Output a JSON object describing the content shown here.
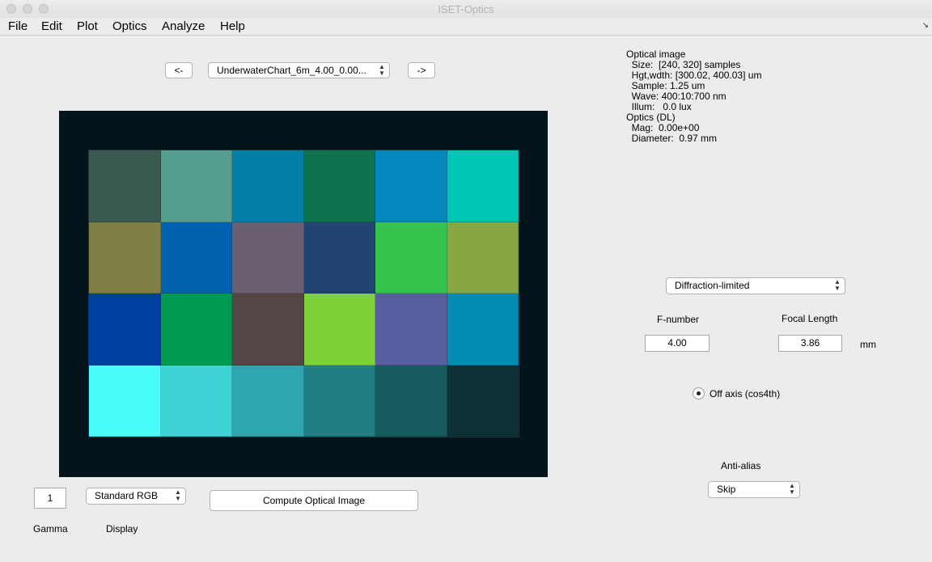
{
  "window": {
    "title": "ISET-Optics"
  },
  "menu": [
    "File",
    "Edit",
    "Plot",
    "Optics",
    "Analyze",
    "Help"
  ],
  "nav": {
    "prev_label": "<-",
    "next_label": "->",
    "scene_selected": "UnderwaterChart_6m_4.00_0.00..."
  },
  "info": {
    "lines": [
      "Optical image",
      "  Size:  [240, 320] samples",
      "  Hgt,wdth: [300.02, 400.03] um",
      "  Sample: 1.25 um",
      "  Wave: 400:10:700 nm",
      "  Illum:   0.0 lux",
      "Optics (DL)",
      "  Mag:  0.00e+00",
      "  Diameter:  0.97 mm"
    ]
  },
  "image": {
    "patches": [
      "#3a5a50",
      "#569e8e",
      "#0480a6",
      "#0e724f",
      "#0487bc",
      "#00c6b5",
      "#807f43",
      "#0262b0",
      "#6a6070",
      "#234473",
      "#36c24d",
      "#88a641",
      "#0040a0",
      "#009b4e",
      "#554646",
      "#7dd23a",
      "#585f9e",
      "#028cb2",
      "#4afcfc",
      "#3ed4d6",
      "#30a6ae",
      "#207e84",
      "#175a60",
      "#0b3036"
    ],
    "background": "#03141c"
  },
  "optics": {
    "model": "Diffraction-limited",
    "fnumber_label": "F-number",
    "fnumber_value": "4.00",
    "focal_label": "Focal Length",
    "focal_value": "3.86",
    "focal_unit": "mm",
    "offaxis_label": "Off axis (cos4th)",
    "offaxis_checked": true,
    "antialias_label": "Anti-alias",
    "antialias_value": "Skip"
  },
  "display": {
    "gamma_value": "1",
    "gamma_label": "Gamma",
    "display_value": "Standard RGB",
    "display_label": "Display",
    "compute_label": "Compute Optical Image"
  }
}
